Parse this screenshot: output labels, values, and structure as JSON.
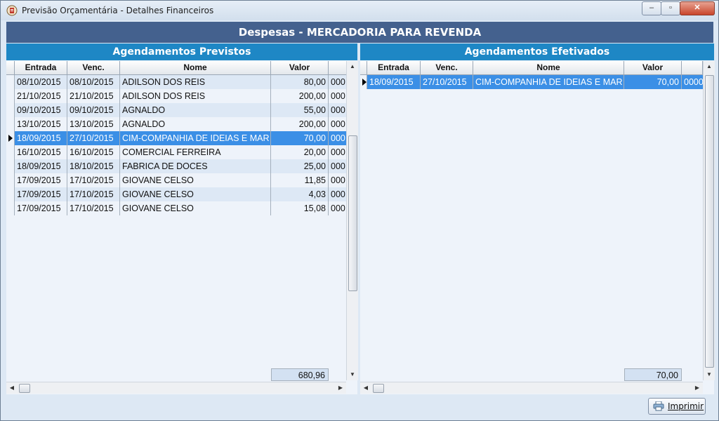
{
  "window": {
    "title": "Previsão Orçamentária - Detalhes Financeiros",
    "minimize": "‒",
    "maximize": "▫",
    "close": "✕"
  },
  "header": {
    "title": "Despesas - MERCADORIA PARA REVENDA"
  },
  "left_panel": {
    "title": "Agendamentos Previstos",
    "columns": [
      "Entrada",
      "Venc.",
      "Nome",
      "Valor",
      ""
    ],
    "rows": [
      {
        "entrada": "08/10/2015",
        "venc": "08/10/2015",
        "nome": "ADILSON DOS REIS",
        "valor": "80,00",
        "extra": "000"
      },
      {
        "entrada": "21/10/2015",
        "venc": "21/10/2015",
        "nome": "ADILSON DOS REIS",
        "valor": "200,00",
        "extra": "000"
      },
      {
        "entrada": "09/10/2015",
        "venc": "09/10/2015",
        "nome": "AGNALDO",
        "valor": "55,00",
        "extra": "000"
      },
      {
        "entrada": "13/10/2015",
        "venc": "13/10/2015",
        "nome": "AGNALDO",
        "valor": "200,00",
        "extra": "000"
      },
      {
        "entrada": "18/09/2015",
        "venc": "27/10/2015",
        "nome": "CIM-COMPANHIA DE IDEIAS E MAR",
        "valor": "70,00",
        "extra": "000",
        "selected": true
      },
      {
        "entrada": "16/10/2015",
        "venc": "16/10/2015",
        "nome": "COMERCIAL FERREIRA",
        "valor": "20,00",
        "extra": "000"
      },
      {
        "entrada": "18/09/2015",
        "venc": "18/10/2015",
        "nome": "FABRICA DE DOCES",
        "valor": "25,00",
        "extra": "000"
      },
      {
        "entrada": "17/09/2015",
        "venc": "17/10/2015",
        "nome": "GIOVANE CELSO",
        "valor": "11,85",
        "extra": "000"
      },
      {
        "entrada": "17/09/2015",
        "venc": "17/10/2015",
        "nome": "GIOVANE CELSO",
        "valor": "4,03",
        "extra": "000"
      },
      {
        "entrada": "17/09/2015",
        "venc": "17/10/2015",
        "nome": "GIOVANE CELSO",
        "valor": "15,08",
        "extra": "000"
      }
    ],
    "total": "680,96"
  },
  "right_panel": {
    "title": "Agendamentos Efetivados",
    "columns": [
      "Entrada",
      "Venc.",
      "Nome",
      "Valor",
      ""
    ],
    "rows": [
      {
        "entrada": "18/09/2015",
        "venc": "27/10/2015",
        "nome": "CIM-COMPANHIA DE IDEIAS E MAR",
        "valor": "70,00",
        "extra": "0000",
        "selected": true
      }
    ],
    "total": "70,00"
  },
  "scroll": {
    "up": "▲",
    "down": "▼",
    "left": "◀",
    "right": "▶",
    "grip": "≡"
  },
  "print_button": {
    "label": "Imprimir"
  },
  "colors": {
    "header_bg": "#44618e",
    "panel_title_bg": "#1e87c5",
    "selection": "#3b8fe6"
  }
}
